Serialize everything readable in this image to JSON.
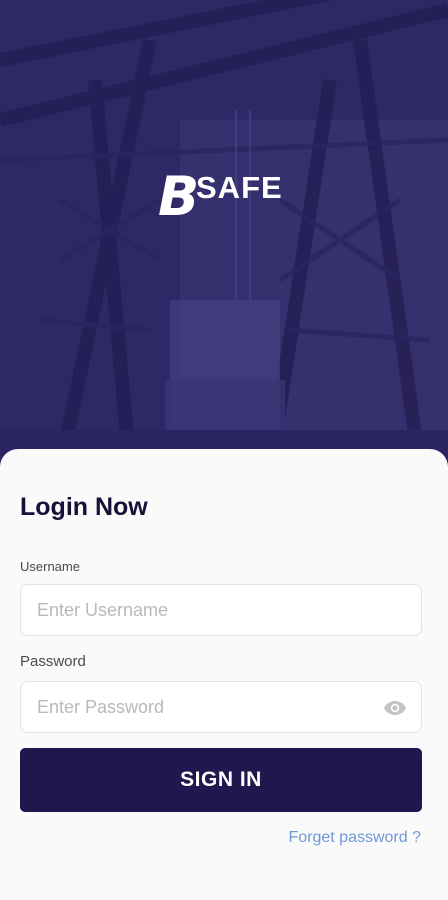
{
  "brand": {
    "logo_letter": "B",
    "logo_word": "SAFE"
  },
  "login": {
    "title": "Login Now",
    "username_label": "Username",
    "username_placeholder": "Enter Username",
    "username_value": "",
    "password_label": "Password",
    "password_placeholder": "Enter Password",
    "password_value": "",
    "password_toggle_icon": "eye-icon",
    "submit_label": "SIGN IN",
    "forgot_label": "Forget password ?"
  },
  "colors": {
    "hero_overlay": "#2f2866",
    "button": "#1f174d",
    "link": "#6f98d6",
    "card": "#fafafa"
  }
}
